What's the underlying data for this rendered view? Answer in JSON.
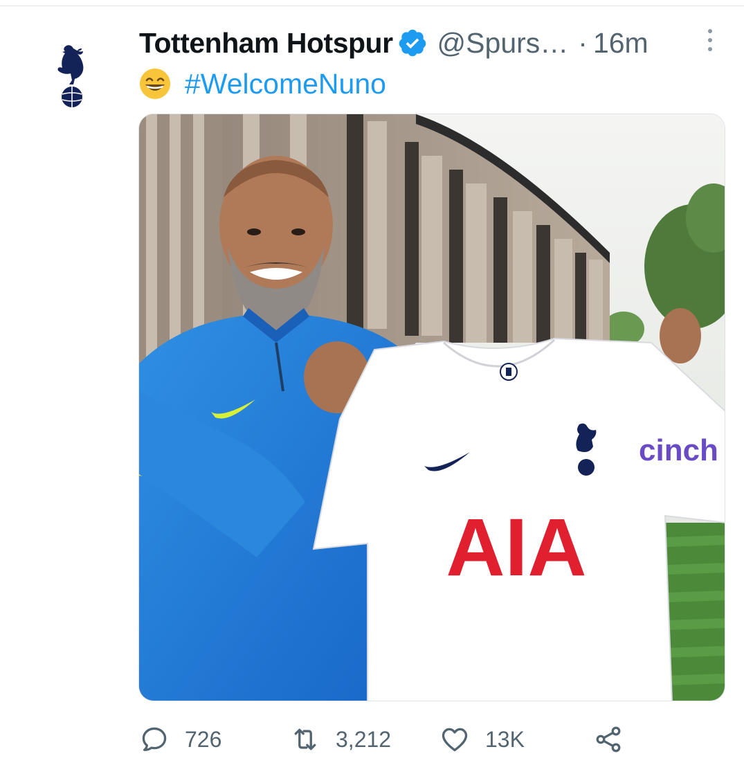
{
  "tweet": {
    "author_name": "Tottenham Hotspur",
    "handle": "@Spurs…",
    "separator": "·",
    "time": "16m",
    "text_hashtag": "#WelcomeNuno",
    "emoji": "grinning-face-emoji",
    "verified": true,
    "media": {
      "shirt_sponsor": "AIA",
      "sleeve_sponsor": "cinch"
    }
  },
  "actions": {
    "reply_count": "726",
    "retweet_count": "3,212",
    "like_count": "13K"
  },
  "icons": {
    "avatar": "cockerel-crest-icon",
    "verified": "verified-badge-icon",
    "more": "more-options-icon",
    "reply": "reply-icon",
    "retweet": "retweet-icon",
    "like": "heart-icon",
    "share": "share-icon"
  },
  "colors": {
    "accent": "#1d9bf0",
    "text": "#0f1419",
    "secondary": "#536471",
    "navy": "#132257",
    "sponsor_red": "#e0202e"
  }
}
